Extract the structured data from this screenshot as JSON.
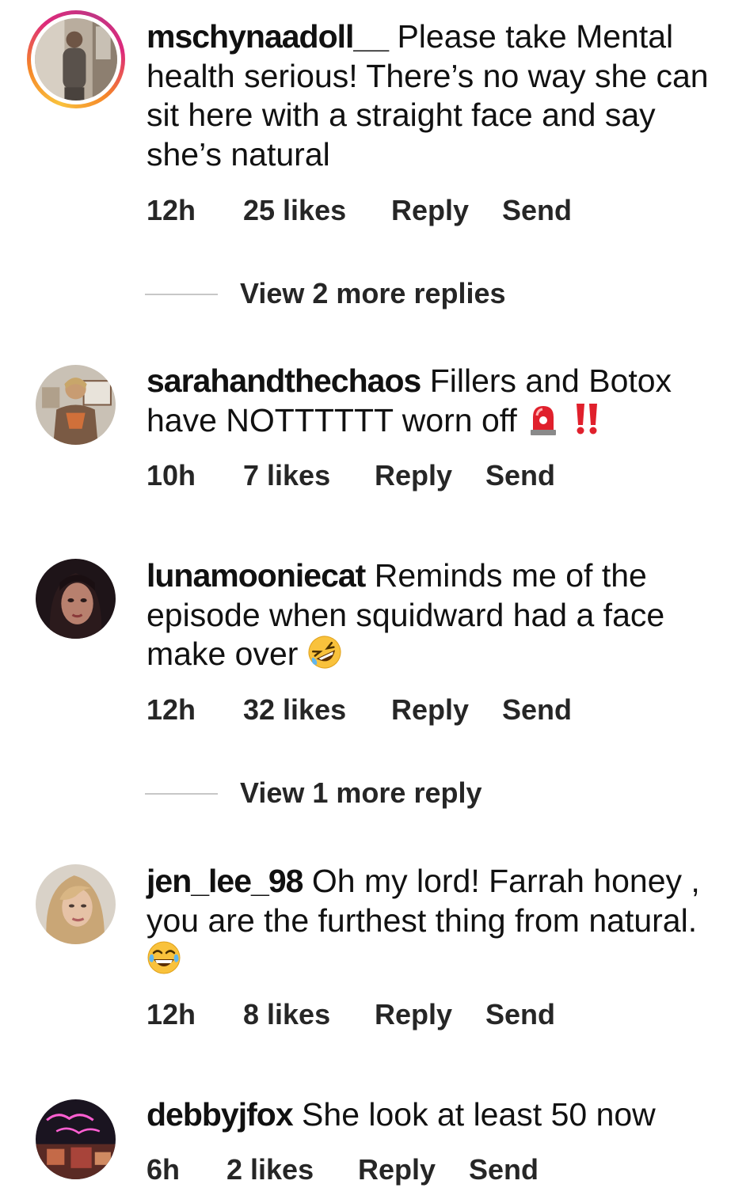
{
  "comments": [
    {
      "username": "mschynaadoll__",
      "text": "Please take Mental health serious! There’s no way she can sit here with a straight face and say she’s natural",
      "time": "12h",
      "likes": "25 likes",
      "reply": "Reply",
      "send": "Send",
      "view_more": "View 2 more replies"
    },
    {
      "username": "sarahandthechaos",
      "text": "Fillers and Botox have NOTTTTTT worn off",
      "emoji": [
        "siren-emoji",
        "double-exclamation-emoji"
      ],
      "time": "10h",
      "likes": "7 likes",
      "reply": "Reply",
      "send": "Send"
    },
    {
      "username": "lunamooniecat",
      "text": "Reminds me of the episode when squidward had a face make over",
      "emoji": [
        "rolling-laughing-emoji"
      ],
      "time": "12h",
      "likes": "32 likes",
      "reply": "Reply",
      "send": "Send",
      "view_more": "View 1 more reply"
    },
    {
      "username": "jen_lee_98",
      "text": "Oh my lord! Farrah honey , you are the furthest thing from natural.",
      "emoji": [
        "tears-of-joy-emoji"
      ],
      "time": "12h",
      "likes": "8 likes",
      "reply": "Reply",
      "send": "Send"
    },
    {
      "username": "debbyjfox",
      "text": "She look at least 50 now",
      "time": "6h",
      "likes": "2 likes",
      "reply": "Reply",
      "send": "Send"
    }
  ],
  "colors": {
    "text": "#111111",
    "meta": "#262626",
    "divider": "#c7c7c7",
    "story_ring": [
      "#f9c23c",
      "#f58529",
      "#dd2a7b",
      "#c13584"
    ],
    "alert_red": "#e0202c"
  }
}
